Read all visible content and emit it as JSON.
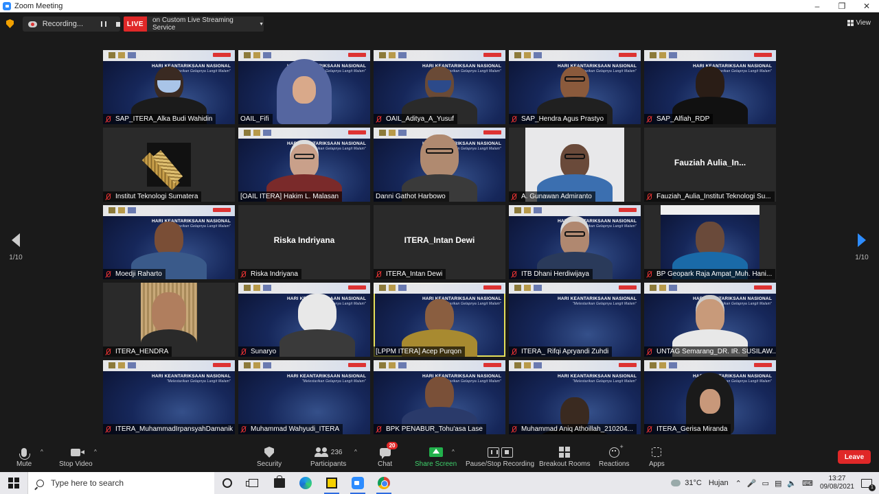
{
  "window": {
    "title": "Zoom Meeting"
  },
  "top_bar": {
    "recording_label": "Recording...",
    "live_label": "LIVE",
    "stream_service": "on Custom Live Streaming Service",
    "view_label": "View"
  },
  "slide_banner": {
    "title": "HARI KEANTARIKSAAN NASIONAL",
    "subtitle": "\"Melestarikan Gelapnya Langit Malam\""
  },
  "pagination": {
    "left": "1/10",
    "right": "1/10"
  },
  "participants": [
    {
      "name": "SAP_ITERA_Alka Budi Wahidin",
      "muted": true
    },
    {
      "name": "OAIL_Fifi",
      "muted": false
    },
    {
      "name": "OAIL_Aditya_A_Yusuf",
      "muted": true
    },
    {
      "name": "SAP_Hendra Agus Prastyo",
      "muted": true
    },
    {
      "name": "SAP_Alfiah_RDP",
      "muted": true
    },
    {
      "name": "Institut Teknologi Sumatera",
      "muted": true
    },
    {
      "name": "[OAIL ITERA] Hakim L. Malasan",
      "muted": false
    },
    {
      "name": "Danni Gathot Harbowo",
      "muted": false
    },
    {
      "name": "A. Gunawan Admiranto",
      "muted": true
    },
    {
      "name": "Fauziah_Aulia_Institut Teknologi Su...",
      "muted": true,
      "display_name": "Fauziah Aulia_In..."
    },
    {
      "name": "Moedji Raharto",
      "muted": true
    },
    {
      "name": "Riska Indriyana",
      "muted": true,
      "display_name": "Riska Indriyana"
    },
    {
      "name": "ITERA_Intan Dewi",
      "muted": true,
      "display_name": "ITERA_Intan Dewi"
    },
    {
      "name": "ITB Dhani Herdiwijaya",
      "muted": true
    },
    {
      "name": "BP Geopark Raja Ampat_Muh. Hani...",
      "muted": true
    },
    {
      "name": "ITERA_HENDRA",
      "muted": true
    },
    {
      "name": "Sunaryo",
      "muted": true
    },
    {
      "name": "[LPPM ITERA] Acep Purqon",
      "muted": false,
      "speaking": true
    },
    {
      "name": "ITERA_ Rifqi Apryandi Zuhdi",
      "muted": true
    },
    {
      "name": "UNTAG Semarang_DR. IR. SUSILAW...",
      "muted": true
    },
    {
      "name": "ITERA_MuhammadIrpansyahDamanik",
      "muted": true
    },
    {
      "name": "Muhammad Wahyudi_ITERA",
      "muted": true
    },
    {
      "name": "BPK PENABUR_Tohu'asa Lase",
      "muted": true
    },
    {
      "name": "Muhammad Aniq Athoillah_210204...",
      "muted": true
    },
    {
      "name": "ITERA_Gerisa Miranda",
      "muted": true
    }
  ],
  "toolbar": {
    "mute": "Mute",
    "stop_video": "Stop Video",
    "security": "Security",
    "participants": "Participants",
    "participants_count": "236",
    "chat": "Chat",
    "chat_badge": "20",
    "share_screen": "Share Screen",
    "pause_stop_recording": "Pause/Stop Recording",
    "breakout_rooms": "Breakout Rooms",
    "reactions": "Reactions",
    "apps": "Apps",
    "leave": "Leave"
  },
  "taskbar": {
    "search_placeholder": "Type here to search",
    "temperature": "31°C",
    "weather": "Hujan",
    "time": "13:27",
    "date": "09/08/2021",
    "notification_count": "1"
  },
  "colors": {
    "live_red": "#e02828",
    "share_green": "#22b14c",
    "speaker_outline": "#e6e05a",
    "nav_arrow_blue": "#2d8cff"
  }
}
